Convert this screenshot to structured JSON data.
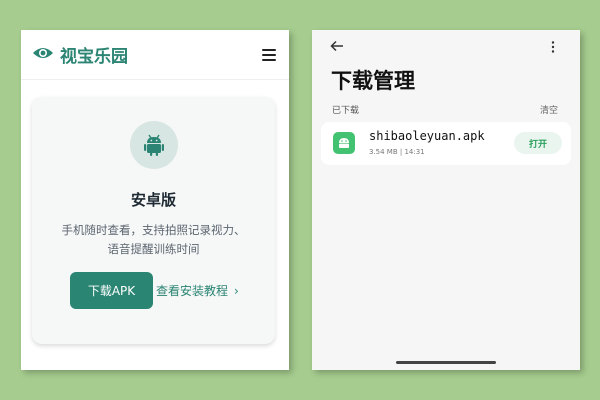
{
  "website": {
    "brand_title": "视宝乐园",
    "card": {
      "title": "安卓版",
      "description_line1": "手机随时查看，支持拍照记录视力、",
      "description_line2": "语音提醒训练时间",
      "download_button": "下载APK",
      "tutorial_link": "查看安装教程",
      "tutorial_arrow": "›"
    },
    "icons": {
      "logo": "eye-icon",
      "menu": "hamburger-menu-icon",
      "platform": "android-icon"
    }
  },
  "download_manager": {
    "title": "下载管理",
    "section_label": "已下载",
    "clear_label": "清空",
    "files": [
      {
        "name": "shibaoleyuan.apk",
        "meta": "3.54 MB | 14:31",
        "action": "打开"
      }
    ],
    "icons": {
      "back": "back-arrow-icon",
      "more": "more-vertical-icon",
      "file": "android-icon"
    }
  },
  "colors": {
    "background": "#a6cd8f",
    "brand": "#2a8573",
    "open_green": "#2aa05e",
    "file_icon": "#43c372"
  }
}
